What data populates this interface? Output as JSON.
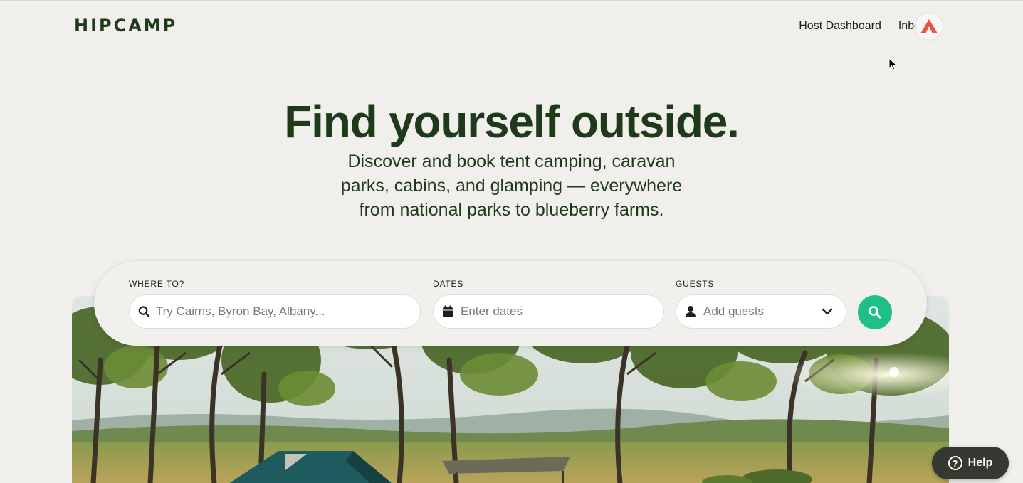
{
  "header": {
    "logo": "HIPCAMP",
    "nav": [
      "Host Dashboard",
      "Inbox"
    ]
  },
  "hero": {
    "title": "Find yourself outside.",
    "subtitle": "Discover and book tent camping, caravan parks, cabins, and glamping — everywhere from national parks to blueberry farms."
  },
  "search": {
    "where_label": "WHERE TO?",
    "where_placeholder": "Try Cairns, Byron Bay, Albany...",
    "dates_label": "DATES",
    "dates_placeholder": "Enter dates",
    "guests_label": "GUESTS",
    "guests_placeholder": "Add guests"
  },
  "help": {
    "label": "Help"
  },
  "colors": {
    "brand": "#1f3a1a",
    "accent": "#1fbf87",
    "background": "#f0efeb",
    "avatar": "#e8523f"
  },
  "icons": [
    "search-icon",
    "calendar-icon",
    "user-icon",
    "chevron-down-icon",
    "question-icon",
    "cursor-icon"
  ]
}
